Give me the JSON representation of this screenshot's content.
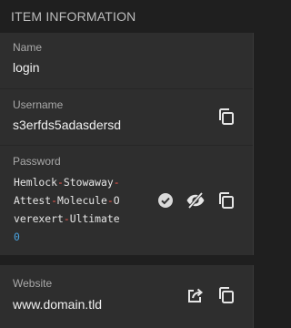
{
  "header": {
    "title": "ITEM INFORMATION"
  },
  "fields": {
    "name": {
      "label": "Name",
      "value": "login"
    },
    "username": {
      "label": "Username",
      "value": "s3erfds5adasdersd"
    },
    "password": {
      "label": "Password",
      "lines": [
        [
          {
            "t": "Hemlock",
            "k": "w"
          },
          {
            "t": "-",
            "k": "d"
          },
          {
            "t": "Stowaway",
            "k": "w"
          },
          {
            "t": "-",
            "k": "d"
          }
        ],
        [
          {
            "t": "Attest",
            "k": "w"
          },
          {
            "t": "-",
            "k": "d"
          },
          {
            "t": "Molecule",
            "k": "w"
          },
          {
            "t": "-",
            "k": "d"
          },
          {
            "t": "O",
            "k": "w"
          }
        ],
        [
          {
            "t": "verexert",
            "k": "w"
          },
          {
            "t": "-",
            "k": "d"
          },
          {
            "t": "Ultimate",
            "k": "w"
          }
        ],
        [
          {
            "t": "0",
            "k": "n"
          }
        ]
      ]
    },
    "website": {
      "label": "Website",
      "value": "www.domain.tld"
    }
  },
  "colors": {
    "background": "#1f1f1f",
    "card": "#2e2e2e",
    "dash": "#ff5a4f",
    "number": "#4aa3e0"
  },
  "icons": {
    "copy": "copy-icon",
    "check": "check-circle-icon",
    "toggle": "eye-slash-icon",
    "launch": "launch-icon"
  }
}
